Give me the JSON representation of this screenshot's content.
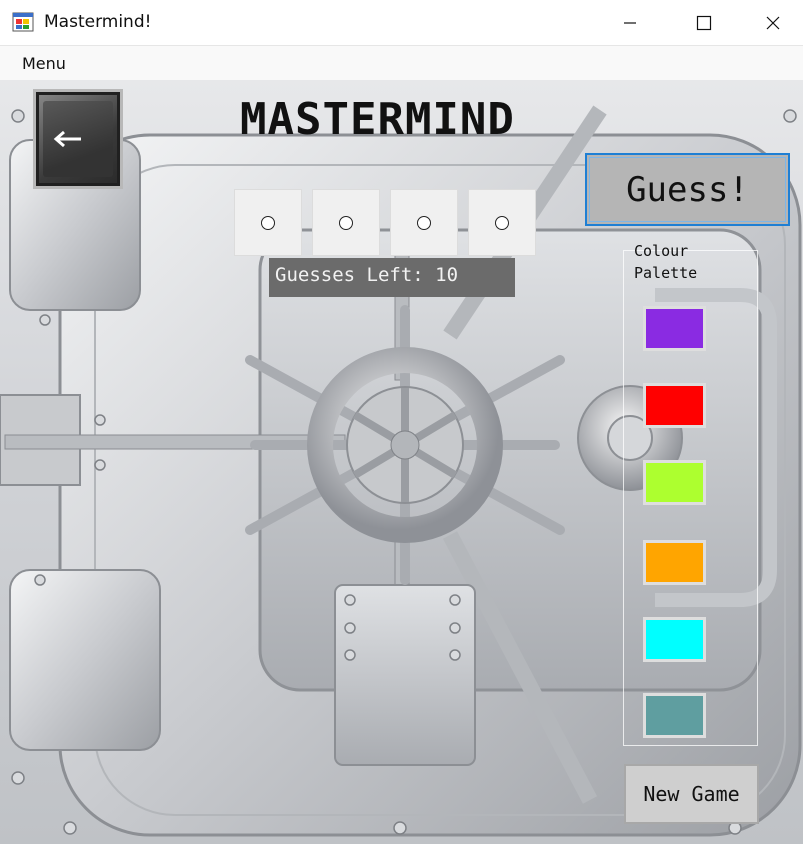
{
  "window": {
    "title": "Mastermind!",
    "icon": "winforms-app-icon",
    "controls": [
      "minimize-icon",
      "maximize-icon",
      "close-icon"
    ]
  },
  "menu": {
    "items": [
      {
        "label": "Menu"
      }
    ]
  },
  "game": {
    "title": "MASTERMIND",
    "back_icon": "left-arrow-icon",
    "guess_label": "Guess!",
    "guesses_left_text": "Guesses Left: 10",
    "slots": [
      {
        "selected": false
      },
      {
        "selected": false
      },
      {
        "selected": false
      },
      {
        "selected": false
      }
    ],
    "palette": {
      "title": "Colour Palette",
      "colors": [
        "#8a2be2",
        "#ff0000",
        "#adff2f",
        "#ffa500",
        "#00ffff",
        "#5f9ea0"
      ]
    },
    "new_game_label": "New Game"
  },
  "colors": {
    "focus_border": "#1e7fd4",
    "guesses_bar": "#6b6b6b"
  }
}
